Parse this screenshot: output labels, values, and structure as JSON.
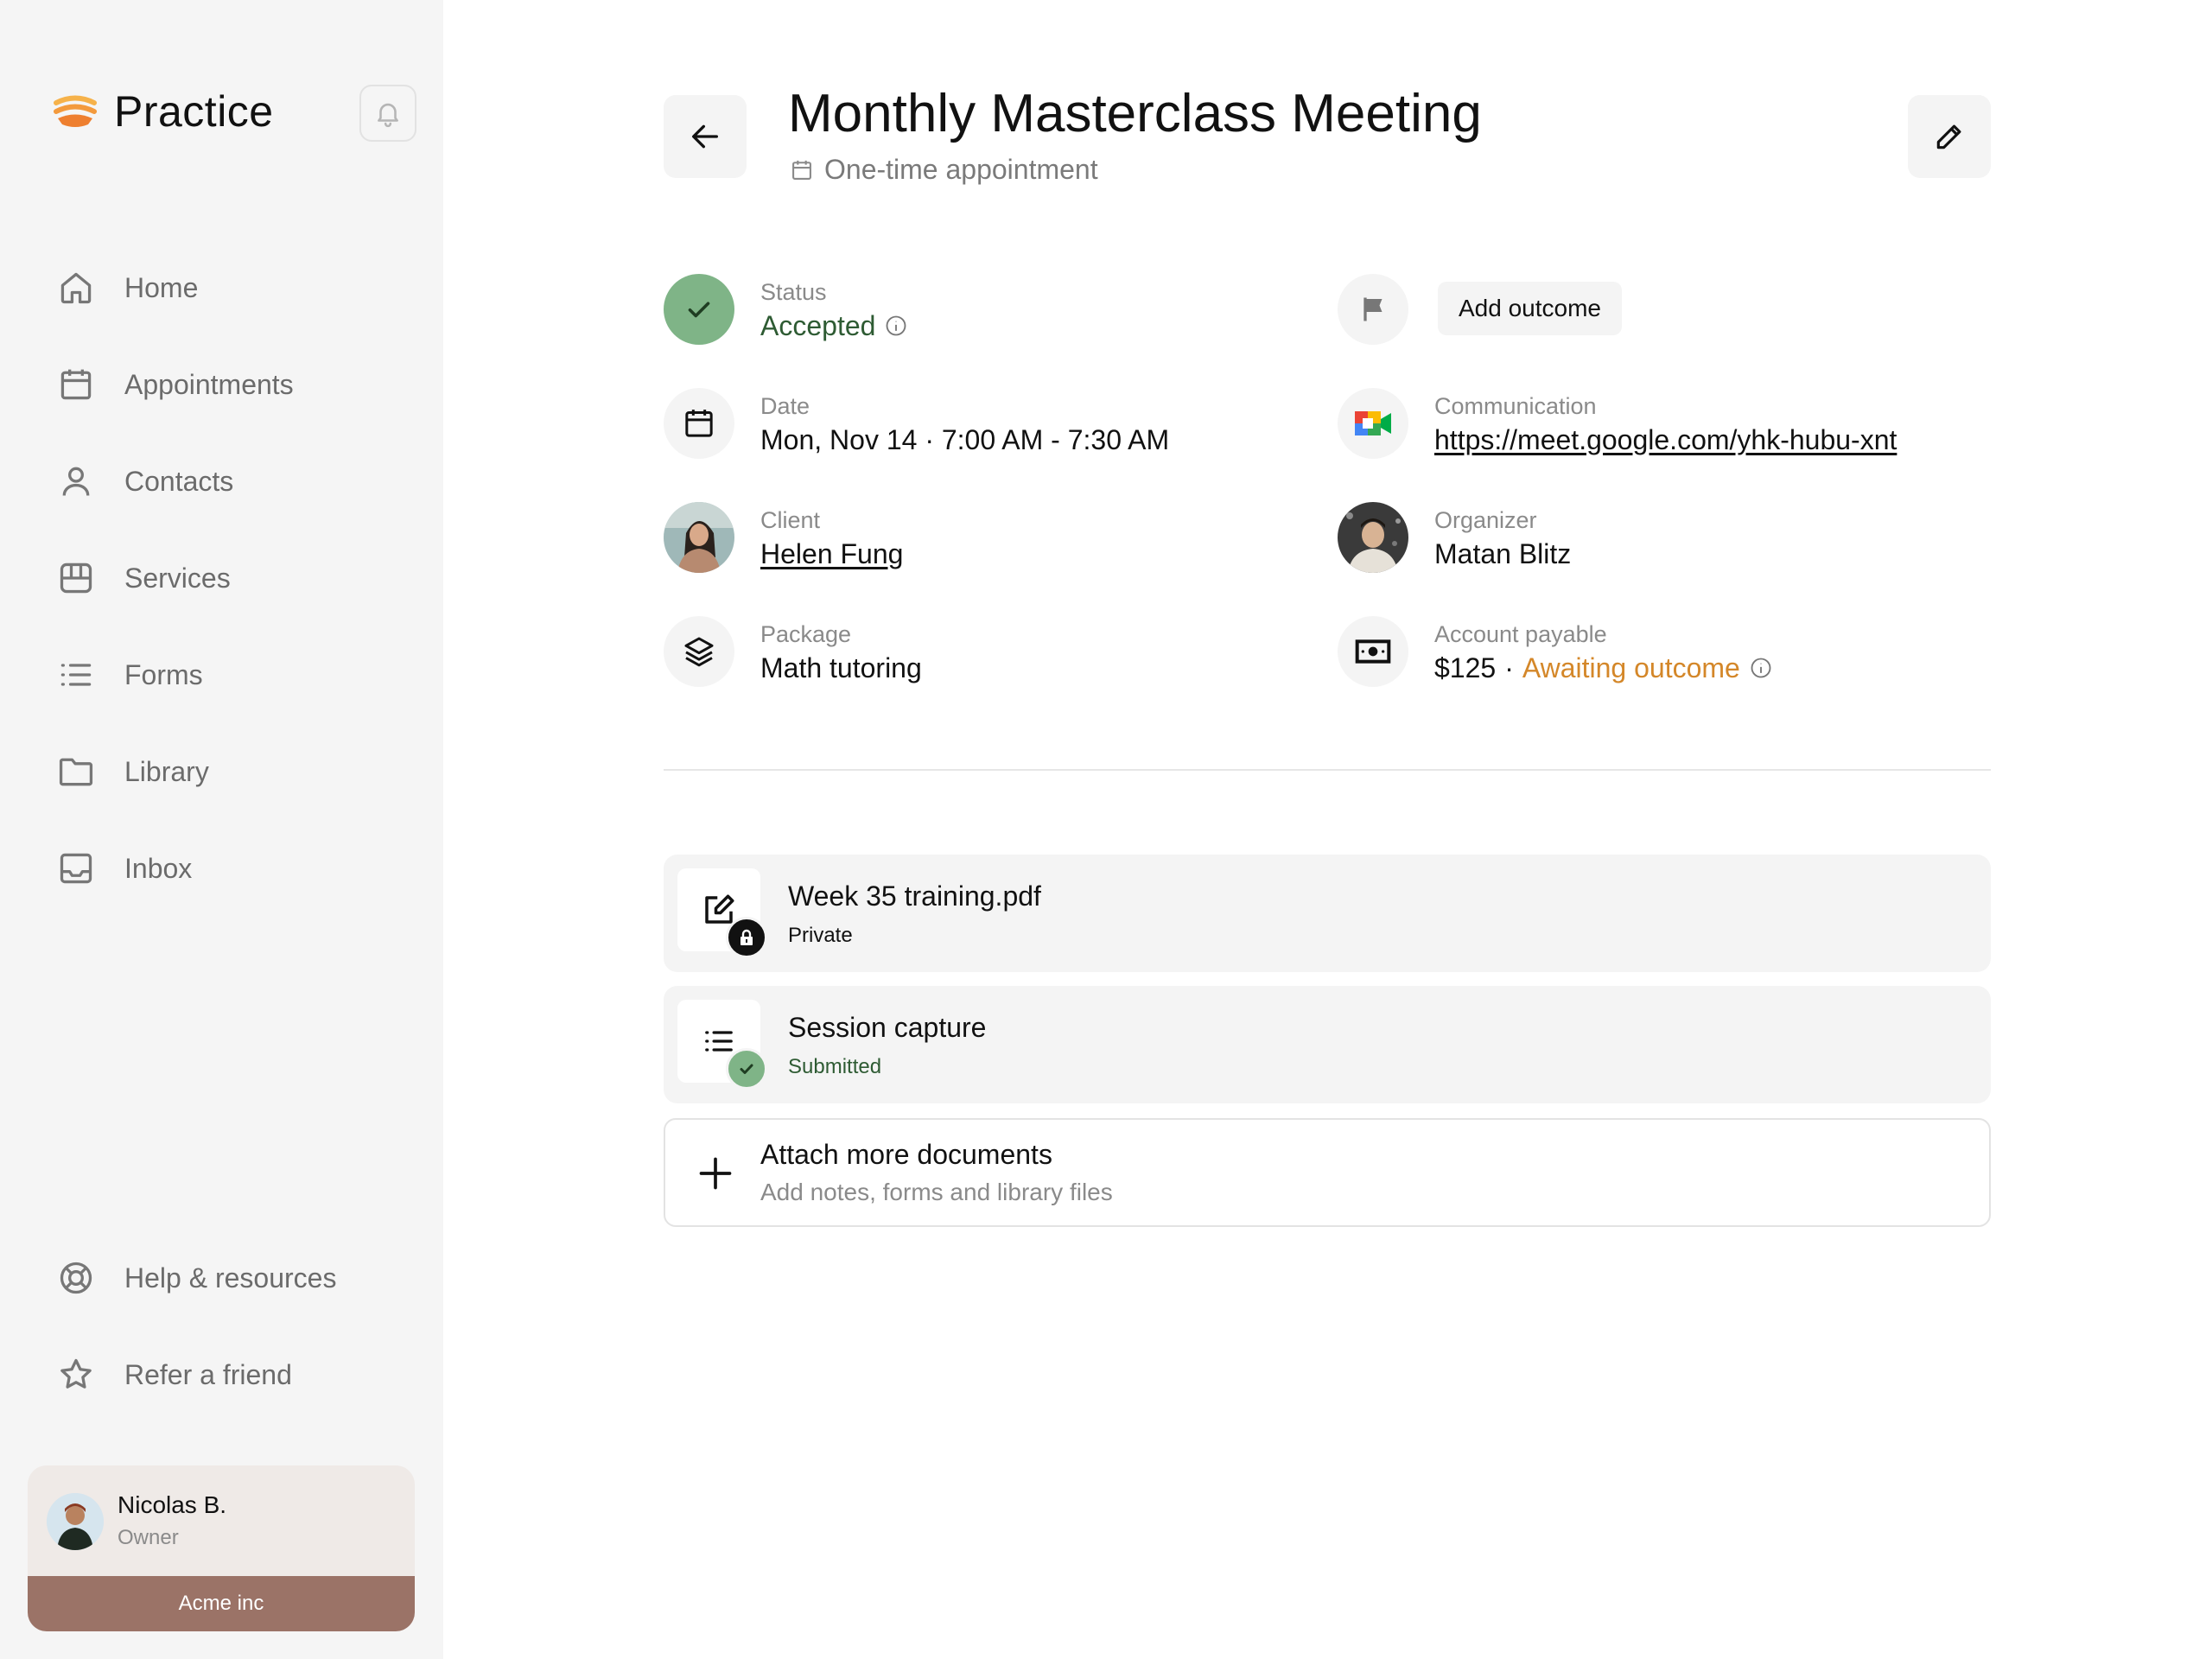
{
  "colors": {
    "sidebar_bg": "#f5f5f5",
    "accent_accepted": "#2e5b33",
    "status_green": "#7fb487",
    "awaiting_orange": "#d48729",
    "org_bar": "#9b7367"
  },
  "sidebar": {
    "app_name": "Practice",
    "nav": [
      {
        "label": "Home",
        "icon": "home-icon"
      },
      {
        "label": "Appointments",
        "icon": "calendar-icon"
      },
      {
        "label": "Contacts",
        "icon": "user-icon"
      },
      {
        "label": "Services",
        "icon": "services-icon"
      },
      {
        "label": "Forms",
        "icon": "list-icon"
      },
      {
        "label": "Library",
        "icon": "folder-icon"
      },
      {
        "label": "Inbox",
        "icon": "inbox-icon"
      }
    ],
    "bottom_nav": [
      {
        "label": "Help & resources",
        "icon": "lifebuoy-icon"
      },
      {
        "label": "Refer a friend",
        "icon": "star-icon"
      }
    ],
    "user": {
      "name": "Nicolas B.",
      "role": "Owner",
      "org": "Acme inc"
    }
  },
  "header": {
    "title": "Monthly Masterclass Meeting",
    "subtitle": "One-time appointment"
  },
  "details": {
    "status": {
      "label": "Status",
      "value": "Accepted"
    },
    "outcome": {
      "button_label": "Add outcome"
    },
    "date": {
      "label": "Date",
      "value": "Mon, Nov 14 · 7:00 AM - 7:30 AM"
    },
    "communication": {
      "label": "Communication",
      "value": "https://meet.google.com/yhk-hubu-xnt"
    },
    "client": {
      "label": "Client",
      "value": "Helen Fung"
    },
    "organizer": {
      "label": "Organizer",
      "value": "Matan Blitz"
    },
    "package": {
      "label": "Package",
      "value": "Math tutoring"
    },
    "account": {
      "label": "Account payable",
      "amount": "$125",
      "separator": "·",
      "status": "Awaiting outcome"
    }
  },
  "documents": [
    {
      "title": "Week 35 training.pdf",
      "subtitle": "Private"
    },
    {
      "title": "Session capture",
      "subtitle": "Submitted"
    }
  ],
  "attach": {
    "title": "Attach more documents",
    "subtitle": "Add notes, forms and library files"
  }
}
